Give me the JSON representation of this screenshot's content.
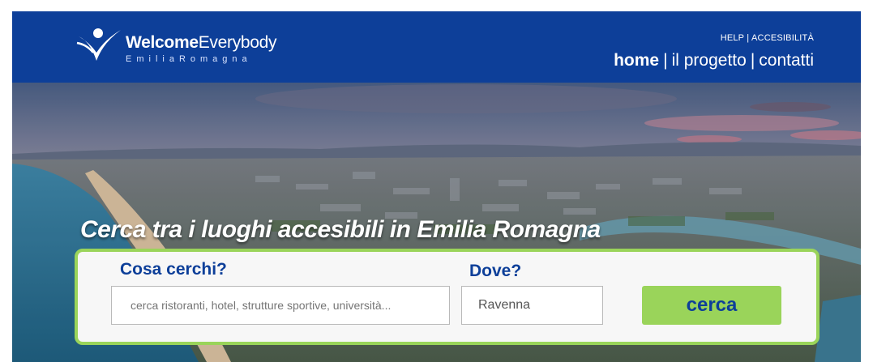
{
  "brand": {
    "name_bold": "Welcome",
    "name_regular": "Everybody",
    "subtitle": "EmiliaRomagna"
  },
  "util_links": {
    "help": "HELP",
    "separator": "|",
    "accessibility": "ACCESIBILITÀ"
  },
  "main_nav": {
    "items": [
      "home",
      "il progetto",
      "contatti"
    ],
    "separator": "|",
    "active": "home"
  },
  "hero": {
    "headline": "Cerca tra i luoghi accesibili in Emilia Romagna"
  },
  "search": {
    "what_label": "Cosa cerchi?",
    "what_placeholder": "cerca ristoranti, hotel, strutture sportive, università...",
    "where_label": "Dove?",
    "where_value": "Ravenna",
    "button_label": "cerca"
  },
  "colors": {
    "header_blue": "#0d3f99",
    "accent_green": "#9ad45a",
    "card_bg": "#f7f7f7"
  }
}
